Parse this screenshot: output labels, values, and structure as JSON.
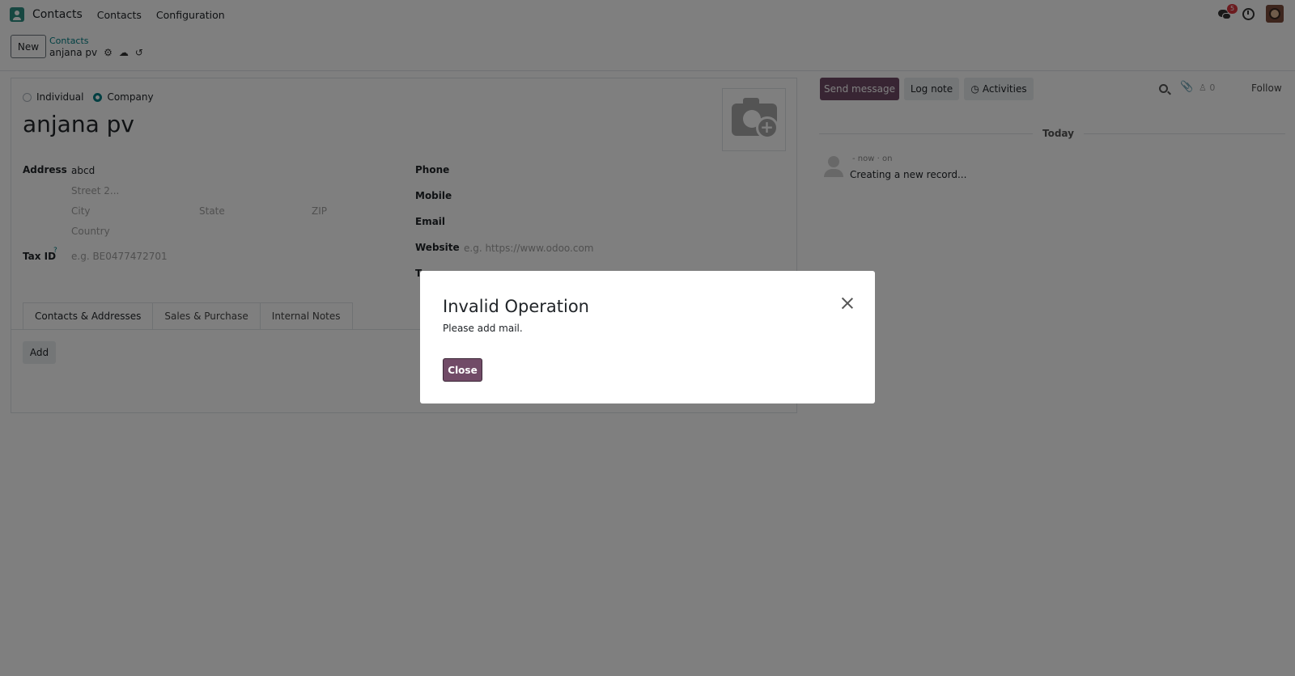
{
  "navbar": {
    "app_name": "Contacts",
    "menu": [
      "Contacts",
      "Configuration"
    ],
    "messages_badge": "5"
  },
  "control": {
    "new_label": "New",
    "breadcrumb": "Contacts",
    "record_name": "anjana pv"
  },
  "form": {
    "type_options": [
      "Individual",
      "Company"
    ],
    "selected_type": "Company",
    "name": "anjana pv",
    "address_label": "Address",
    "street": "abcd",
    "street2_placeholder": "Street 2...",
    "city_placeholder": "City",
    "state_placeholder": "State",
    "zip_placeholder": "ZIP",
    "country_placeholder": "Country",
    "tax_label": "Tax ID",
    "tax_help": "?",
    "tax_placeholder": "e.g. BE0477472701",
    "phone_label": "Phone",
    "mobile_label": "Mobile",
    "email_label": "Email",
    "website_label": "Website",
    "website_placeholder": "e.g. https://www.odoo.com",
    "partial_label": "T",
    "tabs": [
      "Contacts & Addresses",
      "Sales & Purchase",
      "Internal Notes"
    ],
    "add_label": "Add"
  },
  "chatter": {
    "send_label": "Send message",
    "log_label": "Log note",
    "activities_label": "Activities",
    "followers_count": "0",
    "follow_label": "Follow",
    "date_divider": "Today",
    "message_meta": "- now · on",
    "message_text": "Creating a new record..."
  },
  "modal": {
    "title": "Invalid Operation",
    "body": "Please add mail.",
    "close_label": "Close"
  },
  "colors": {
    "primary": "#714b67",
    "accent": "#017e84"
  }
}
